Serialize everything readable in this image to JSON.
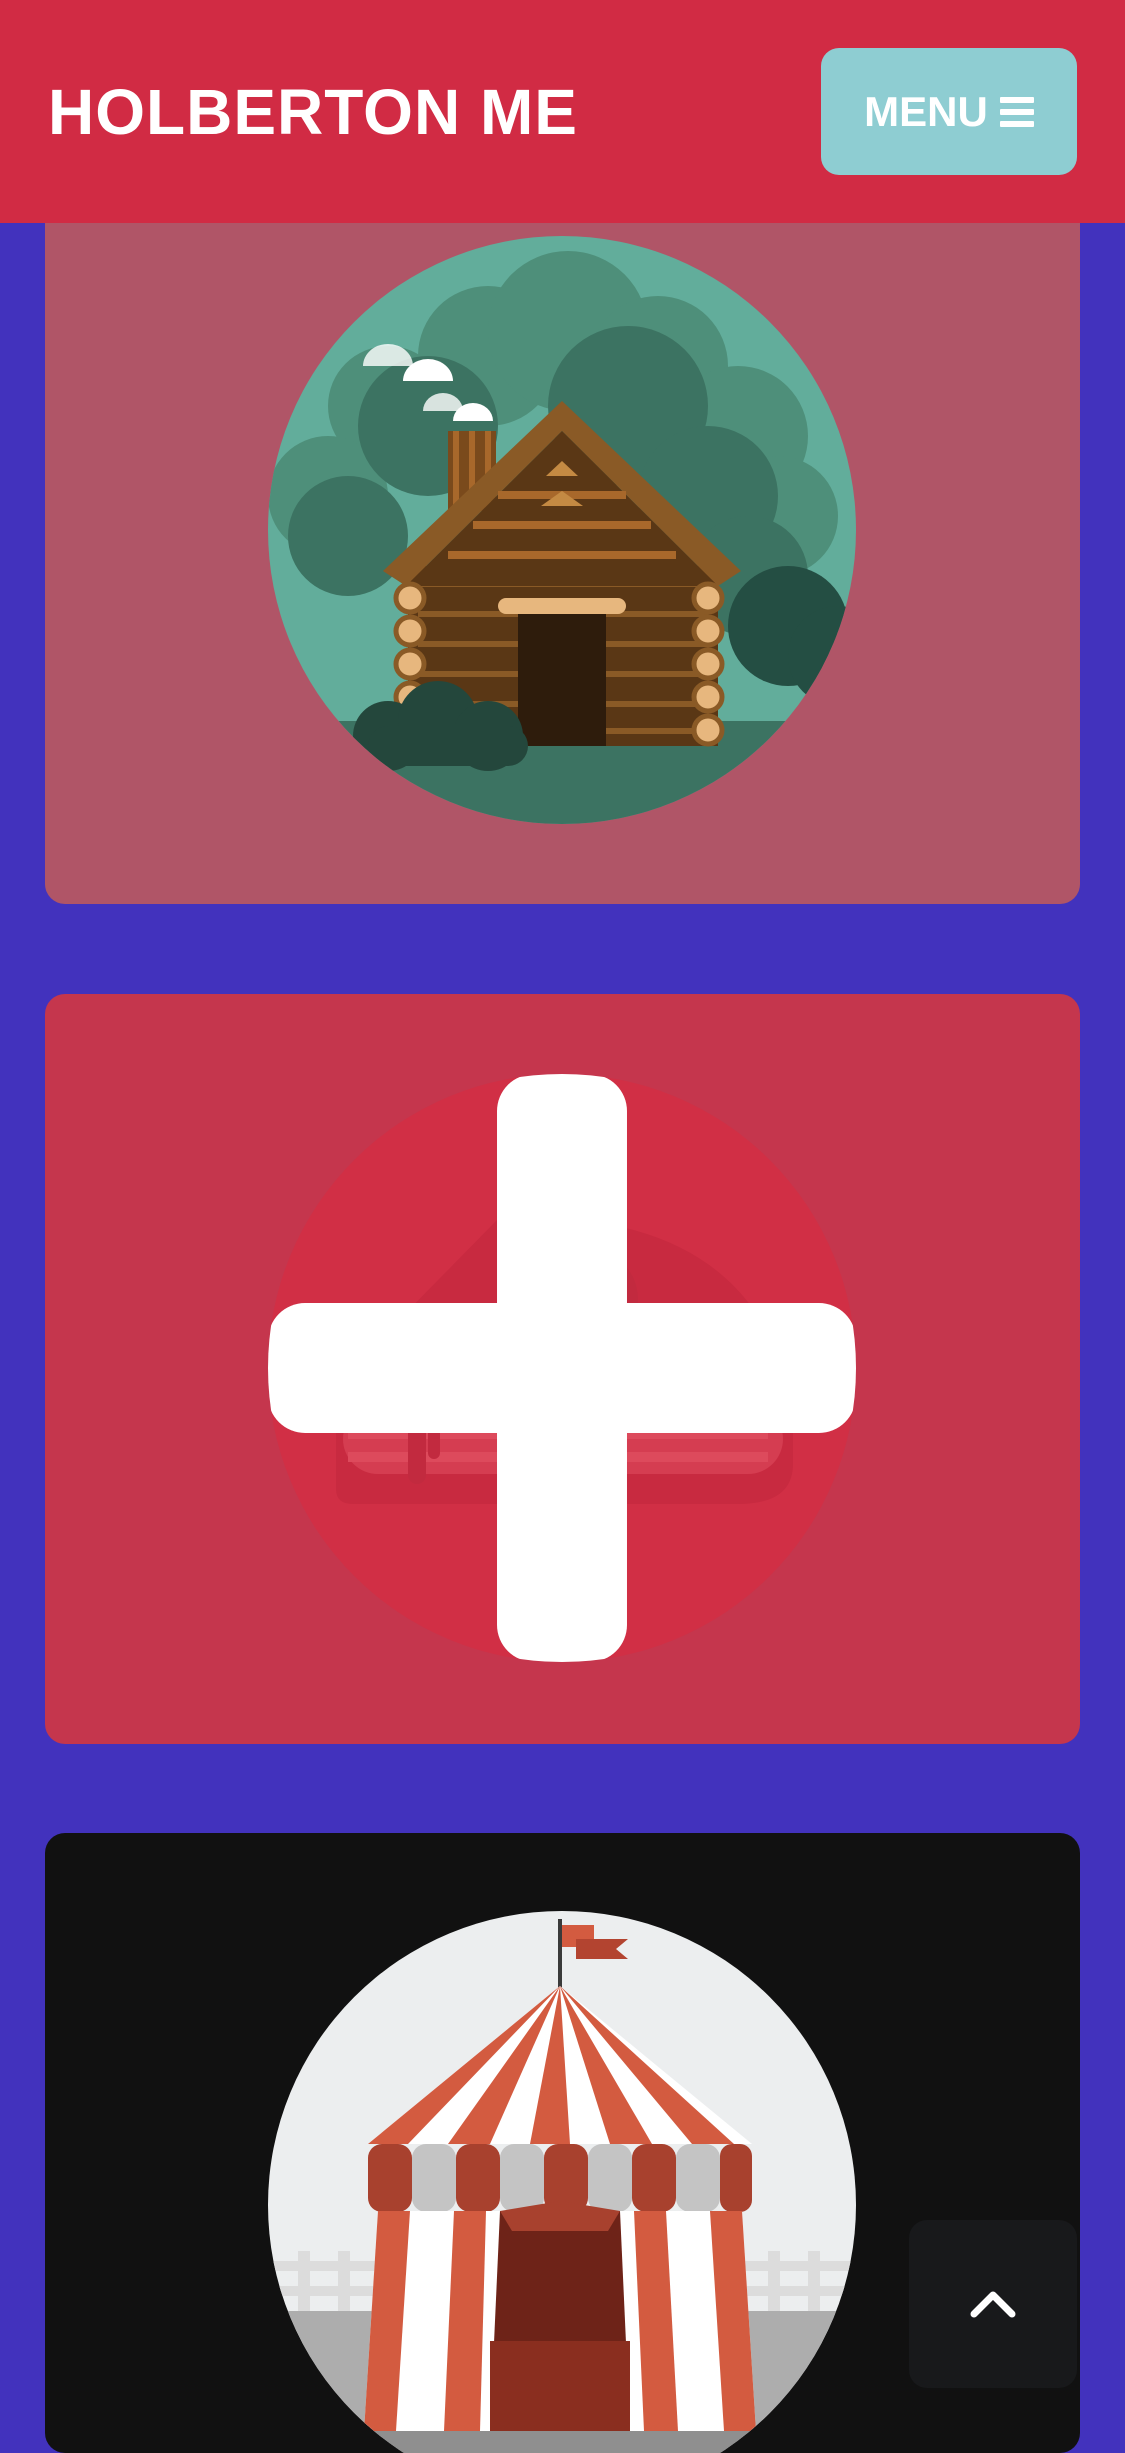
{
  "header": {
    "brand": "HOLBERTON ME",
    "menu_label": "MENU",
    "menu_icon": "hamburger-icon"
  },
  "colors": {
    "background": "#4232bd",
    "header": "#d12b44",
    "menu_button": "#8ecdd2",
    "card_cabin": "#b05567",
    "card_add": "#c5364d",
    "card_circus": "#111111",
    "back_to_top": "#18191b"
  },
  "cards": [
    {
      "illustration": "log-cabin-illustration"
    },
    {
      "illustration": "add-project-placeholder",
      "icon": "plus-icon"
    },
    {
      "illustration": "circus-tent-illustration"
    }
  ],
  "back_to_top": {
    "icon": "chevron-up-icon"
  }
}
